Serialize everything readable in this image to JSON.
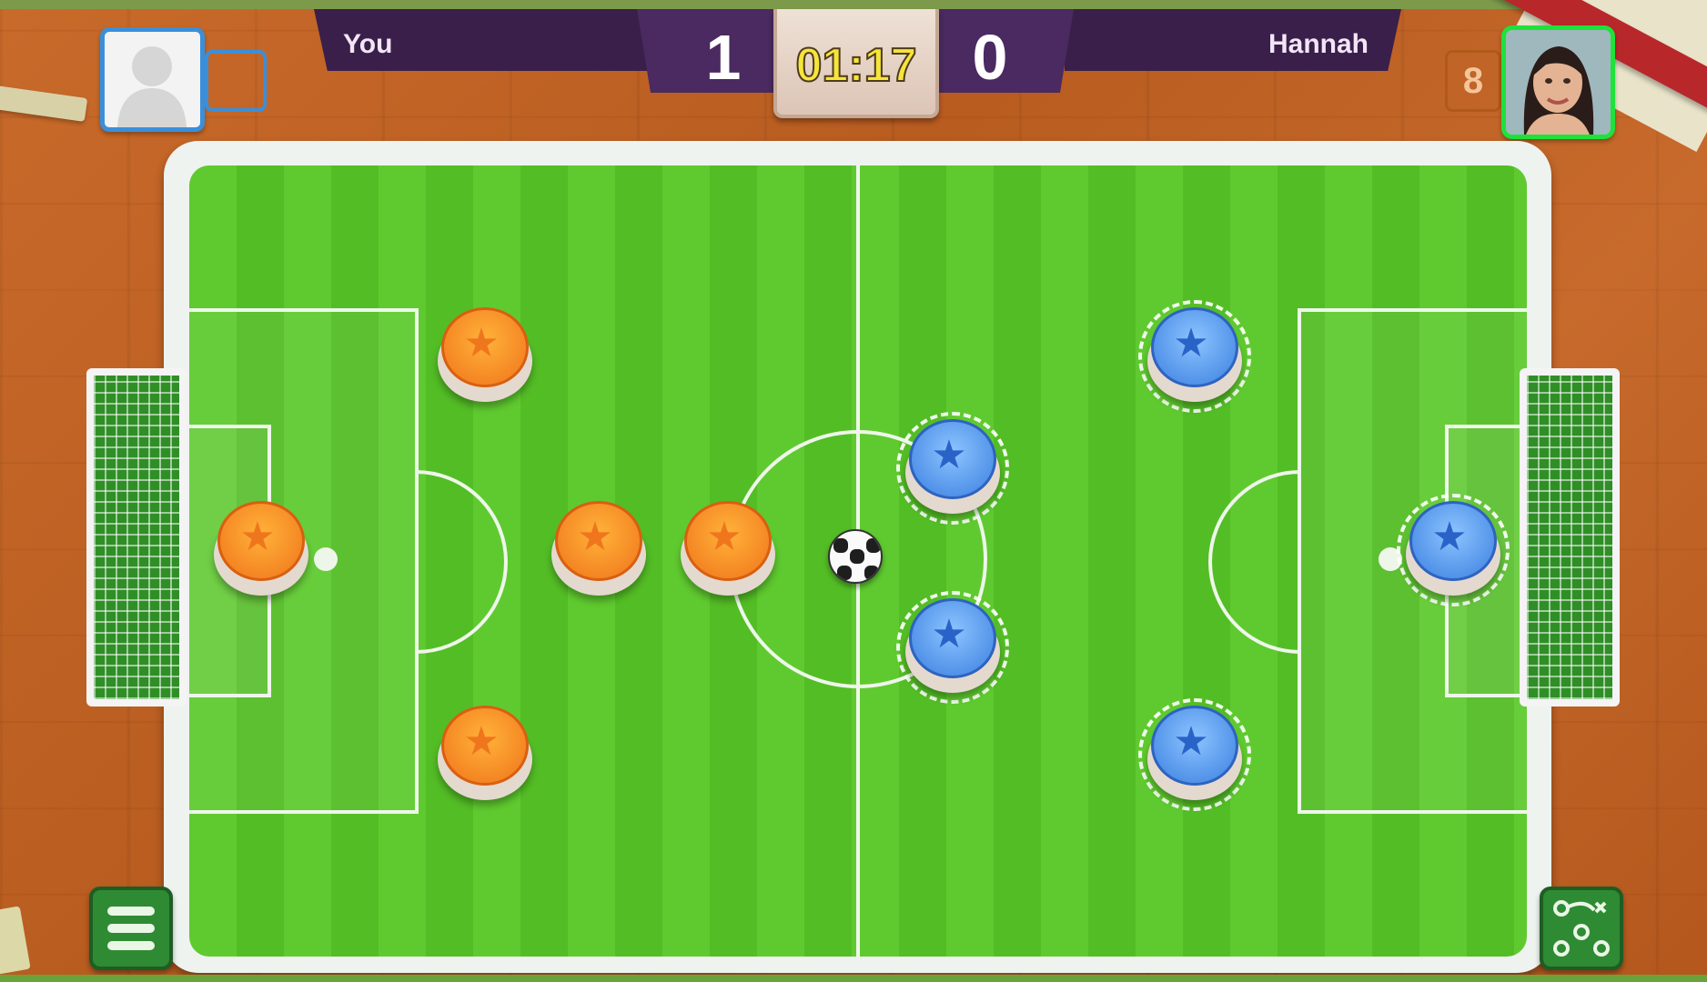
{
  "players": {
    "left": {
      "name": "You",
      "score": "1",
      "avatar": "default-avatar-icon"
    },
    "right": {
      "name": "Hannah",
      "score": "0",
      "avatar": "player-photo",
      "level": "8"
    }
  },
  "match": {
    "timer": "01:17"
  },
  "teams": {
    "left": {
      "color": "#f0761d",
      "piece_icon": "star-icon",
      "piece_count": 5
    },
    "right": {
      "color": "#3b7fe0",
      "piece_icon": "star-icon",
      "piece_count": 5
    }
  },
  "controls": {
    "menu_icon": "hamburger-menu-icon",
    "tactics_icon": "tactics-board-icon"
  },
  "colors": {
    "pitch_light": "#5fca2f",
    "pitch_dark": "#53bd25",
    "scoreboard": "#3a1f4a",
    "timer_text": "#f6e53a",
    "active_player_border": "#1ee23a"
  }
}
